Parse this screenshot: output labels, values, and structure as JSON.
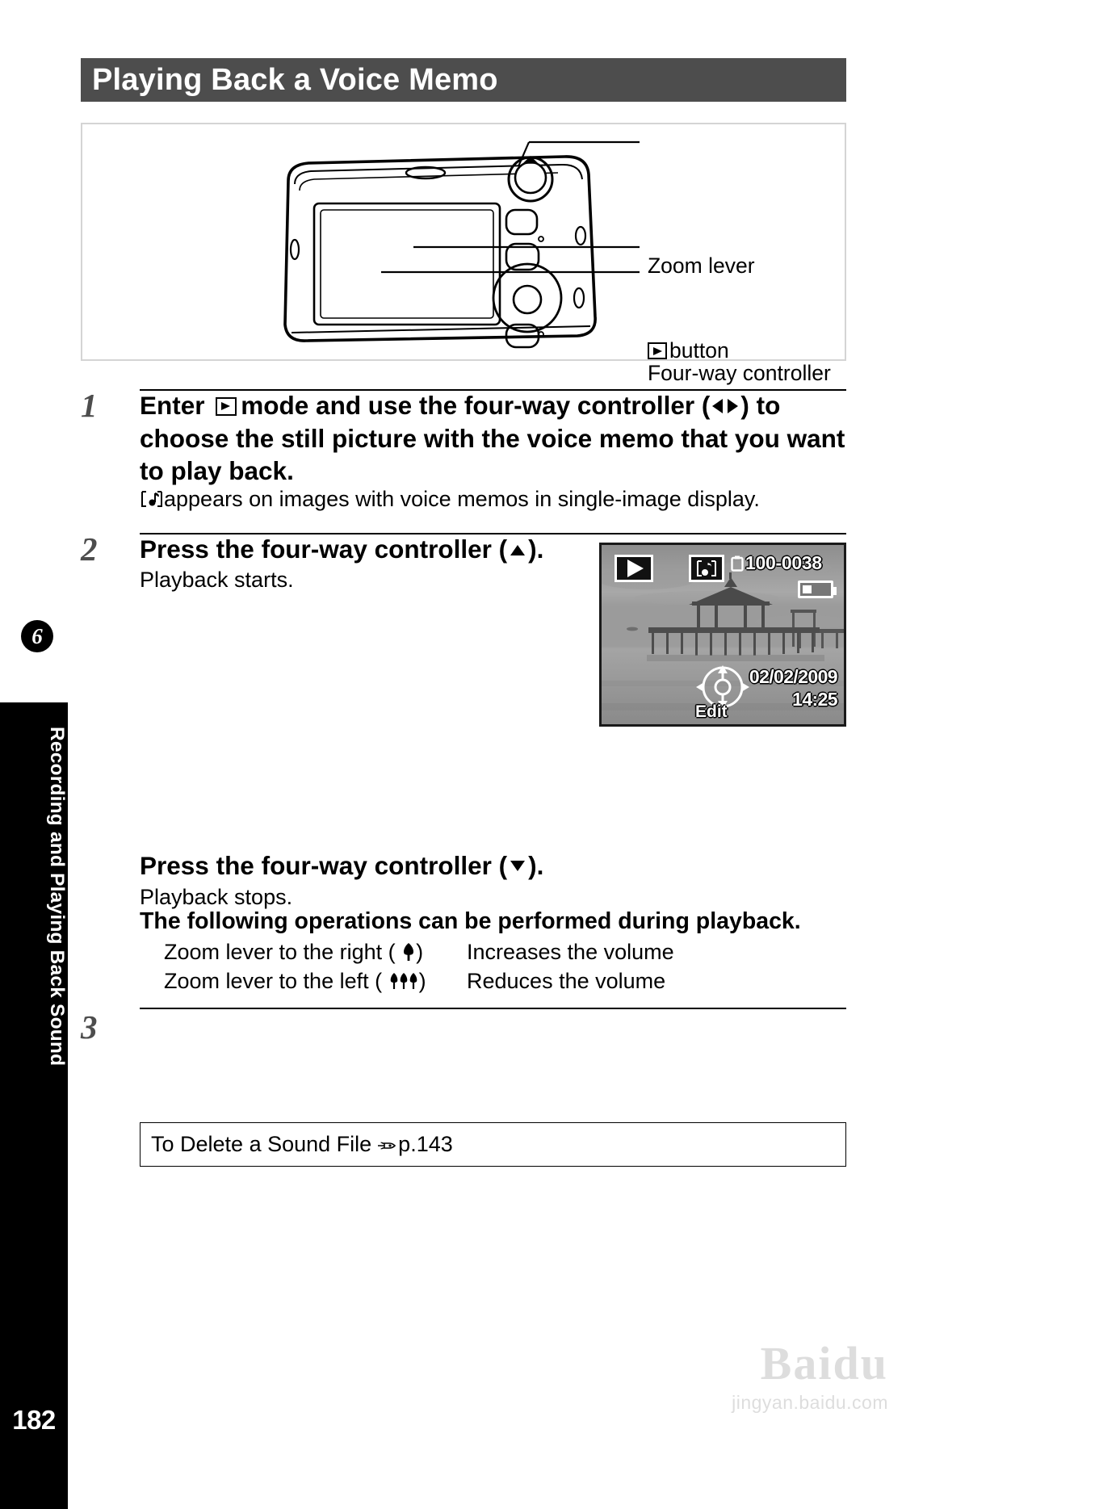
{
  "page": {
    "number": "182",
    "chapter_badge": "6",
    "chapter_title": "Recording and Playing Back Sound",
    "title": "Playing Back a Voice Memo"
  },
  "figure": {
    "callouts": {
      "zoom_lever": "Zoom lever",
      "playback_button": "button",
      "playback_button_icon": "playback-icon",
      "four_way": "Four-way controller"
    }
  },
  "steps": [
    {
      "number": "1",
      "head_part1": "Enter",
      "head_icon": "playback-icon",
      "head_part2": "mode and use the four-way controller (",
      "head_arrows": [
        "left-arrow-icon",
        "right-arrow-icon"
      ],
      "head_part3": ") to choose the still picture with the voice memo that you want to play back.",
      "body_icon": "voice-memo-icon",
      "body": "appears on images with voice memos in single-image display."
    },
    {
      "number": "2",
      "head_part1": "Press the four-way controller (",
      "head_arrow": "up-arrow-icon",
      "head_part2": ").",
      "body": "Playback starts."
    },
    {
      "number": "3",
      "head_part1": "Press the four-way controller (",
      "head_arrow": "down-arrow-icon",
      "head_part2": ").",
      "body": "Playback stops."
    }
  ],
  "lcd": {
    "play_icon": "playback-icon",
    "memo_icon": "voice-memo-icon",
    "file_number": "100-0038",
    "battery_icon": "battery-icon",
    "date": "02/02/2009",
    "time": "14:25",
    "edit_label": "Edit",
    "pad_icon": "four-way-pad-icon"
  },
  "operations": {
    "heading": "The following operations can be performed during playback.",
    "rows": [
      {
        "label_pre": "Zoom lever to the right (",
        "icon": "telephoto-tree-icon",
        "label_post": ")",
        "action": "Increases the volume"
      },
      {
        "label_pre": "Zoom lever to the left (",
        "icon": "wide-angle-trees-icon",
        "label_post": ")",
        "action": "Reduces the volume"
      }
    ]
  },
  "reference": {
    "text_pre": "To Delete a Sound File",
    "icon": "pointing-hand-icon",
    "text_post": "p.143"
  },
  "watermark": {
    "main": "Baidu",
    "sub": "jingyan.baidu.com"
  },
  "colors": {
    "title_bar_bg": "#4d4d4d",
    "figure_border": "#d4d4d4",
    "sidebar_bg": "#000000",
    "step_number": "#4d4d4d"
  }
}
